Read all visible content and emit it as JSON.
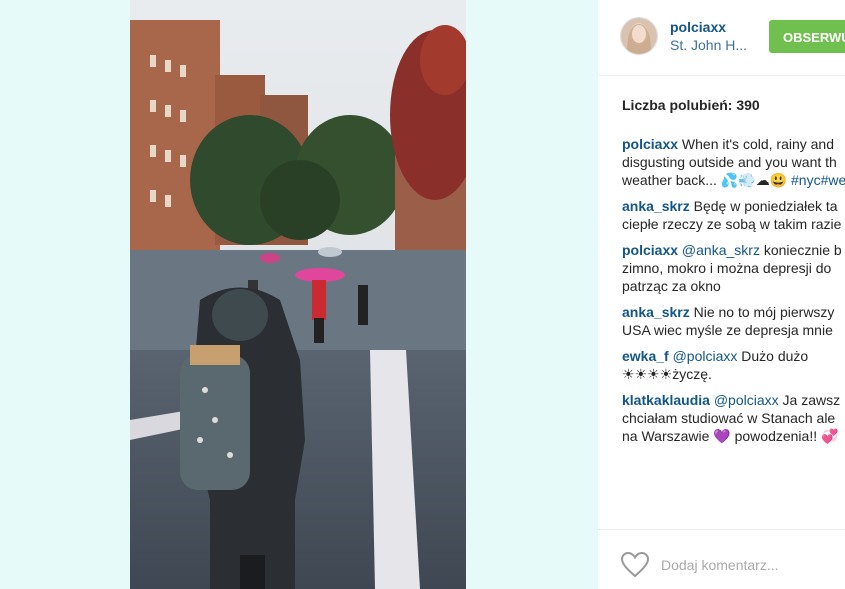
{
  "post": {
    "username": "polciaxx",
    "location": "St. John H...",
    "follow_label": "OBSERWUJ",
    "likes_text": "Liczba polubień: 390"
  },
  "comments": [
    {
      "author": "polciaxx",
      "lines": [
        "When it's cold, rainy and",
        "disgusting outside and you want th",
        "weather back... 💦💨☁😃 "
      ],
      "tag": "#nyc#we"
    },
    {
      "author": "anka_skrz",
      "lines": [
        "Będę w poniedziałek ta",
        "ciepłe rzeczy ze sobą w takim razie"
      ]
    },
    {
      "author": "polciaxx",
      "mention": "@anka_skrz",
      "lines": [
        "koniecznie b",
        "zimno, mokro i można depresji do",
        "patrząc za okno"
      ]
    },
    {
      "author": "anka_skrz",
      "lines": [
        "Nie no to mój pierwszy",
        "USA wiec myśle ze depresja mnie"
      ]
    },
    {
      "author": "ewka_f",
      "mention": "@polciaxx",
      "lines": [
        "Dużo dużo",
        "☀☀☀☀życzę."
      ]
    },
    {
      "author": "klatkaklaudia",
      "mention": "@polciaxx",
      "lines": [
        "Ja zawsz",
        "chciałam studiować w Stanach ale",
        "na Warszawie 💜 powodzenia!! 💞"
      ]
    }
  ],
  "footer": {
    "add_comment_placeholder": "Dodaj komentarz..."
  },
  "icons": {
    "like": "heart-outline-icon"
  }
}
